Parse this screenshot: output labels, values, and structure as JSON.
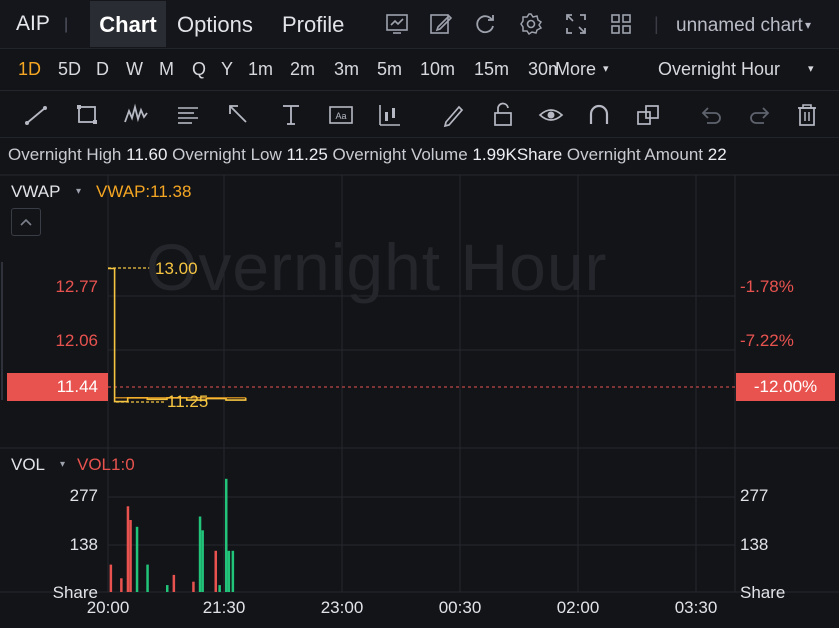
{
  "header": {
    "ticker": "AIP",
    "separator": "|",
    "tabs": [
      "Chart",
      "Options",
      "Profile"
    ],
    "active_tab": "Chart",
    "chart_name": "unnamed chart",
    "chart_name_caret": "▾",
    "icons": [
      "chart-type-icon",
      "edit-icon",
      "refresh-icon",
      "settings-icon",
      "fullscreen-icon",
      "layout-grid-icon"
    ]
  },
  "periods": {
    "items": [
      "1D",
      "5D",
      "D",
      "W",
      "M",
      "Q",
      "Y",
      "1m",
      "2m",
      "3m",
      "5m",
      "10m",
      "15m",
      "30m"
    ],
    "active": "1D",
    "more_label": "More",
    "more_caret": "▾",
    "session": "Overnight Hour",
    "session_caret": "▾"
  },
  "draw_tools": [
    "trend-line-icon",
    "rectangle-icon",
    "pattern-icon",
    "fibonacci-icon",
    "arrow-icon",
    "measure-icon",
    "text-icon",
    "indicator-icon",
    "pen-icon",
    "unlock-icon",
    "eye-icon",
    "magnet-icon",
    "clone-icon",
    "undo-icon",
    "redo-icon",
    "trash-icon"
  ],
  "stats": {
    "high_label": "Overnight High",
    "high_value": "11.60",
    "low_label": "Overnight Low",
    "low_value": "11.25",
    "volume_label": "Overnight Volume",
    "volume_value": "1.99KShare",
    "amount_label": "Overnight Amount",
    "amount_value": "22"
  },
  "price_pane": {
    "indicator": "VWAP",
    "indicator_caret": "▾",
    "indicator_value": "VWAP:11.38",
    "watermark": "Overnight Hour",
    "left_ticks": [
      "12.77",
      "12.06"
    ],
    "right_ticks": [
      "-1.78%",
      "-7.22%"
    ],
    "last_price": "11.44",
    "last_pct": "-12.00%",
    "high_annotation": "13.00",
    "low_annotation": "11.25"
  },
  "volume_pane": {
    "indicator": "VOL",
    "indicator_caret": "▾",
    "indicator_value": "VOL1:0",
    "left_ticks": [
      "277",
      "138",
      "Share"
    ],
    "right_ticks": [
      "277",
      "138",
      "Share"
    ]
  },
  "x_axis": [
    "20:00",
    "21:30",
    "23:00",
    "00:30",
    "02:00",
    "03:30"
  ],
  "colors": {
    "up": "#22c47a",
    "down": "#e8534f",
    "accent": "#f5a623",
    "annotation": "#f5c542",
    "background": "#131418"
  },
  "chart_data": {
    "type": "line",
    "price_series": {
      "x": [
        "20:00",
        "20:05",
        "20:15",
        "20:30",
        "20:45",
        "21:00",
        "21:15",
        "21:30",
        "21:45"
      ],
      "values": [
        13.0,
        11.25,
        11.3,
        11.28,
        11.3,
        11.27,
        11.29,
        11.27,
        11.3
      ]
    },
    "price_ylim": [
      11.1,
      13.1
    ],
    "volume_series": {
      "x": [
        "20:02",
        "20:10",
        "20:15",
        "20:17",
        "20:22",
        "20:30",
        "20:45",
        "20:50",
        "21:05",
        "21:10",
        "21:12",
        "21:22",
        "21:25",
        "21:30",
        "21:32",
        "21:35"
      ],
      "values": [
        80,
        40,
        250,
        210,
        190,
        80,
        20,
        50,
        30,
        220,
        180,
        120,
        20,
        330,
        120,
        120
      ],
      "up": [
        false,
        false,
        false,
        false,
        true,
        true,
        true,
        false,
        false,
        true,
        true,
        false,
        true,
        true,
        true,
        true
      ]
    },
    "volume_ylim": [
      0,
      340
    ]
  }
}
